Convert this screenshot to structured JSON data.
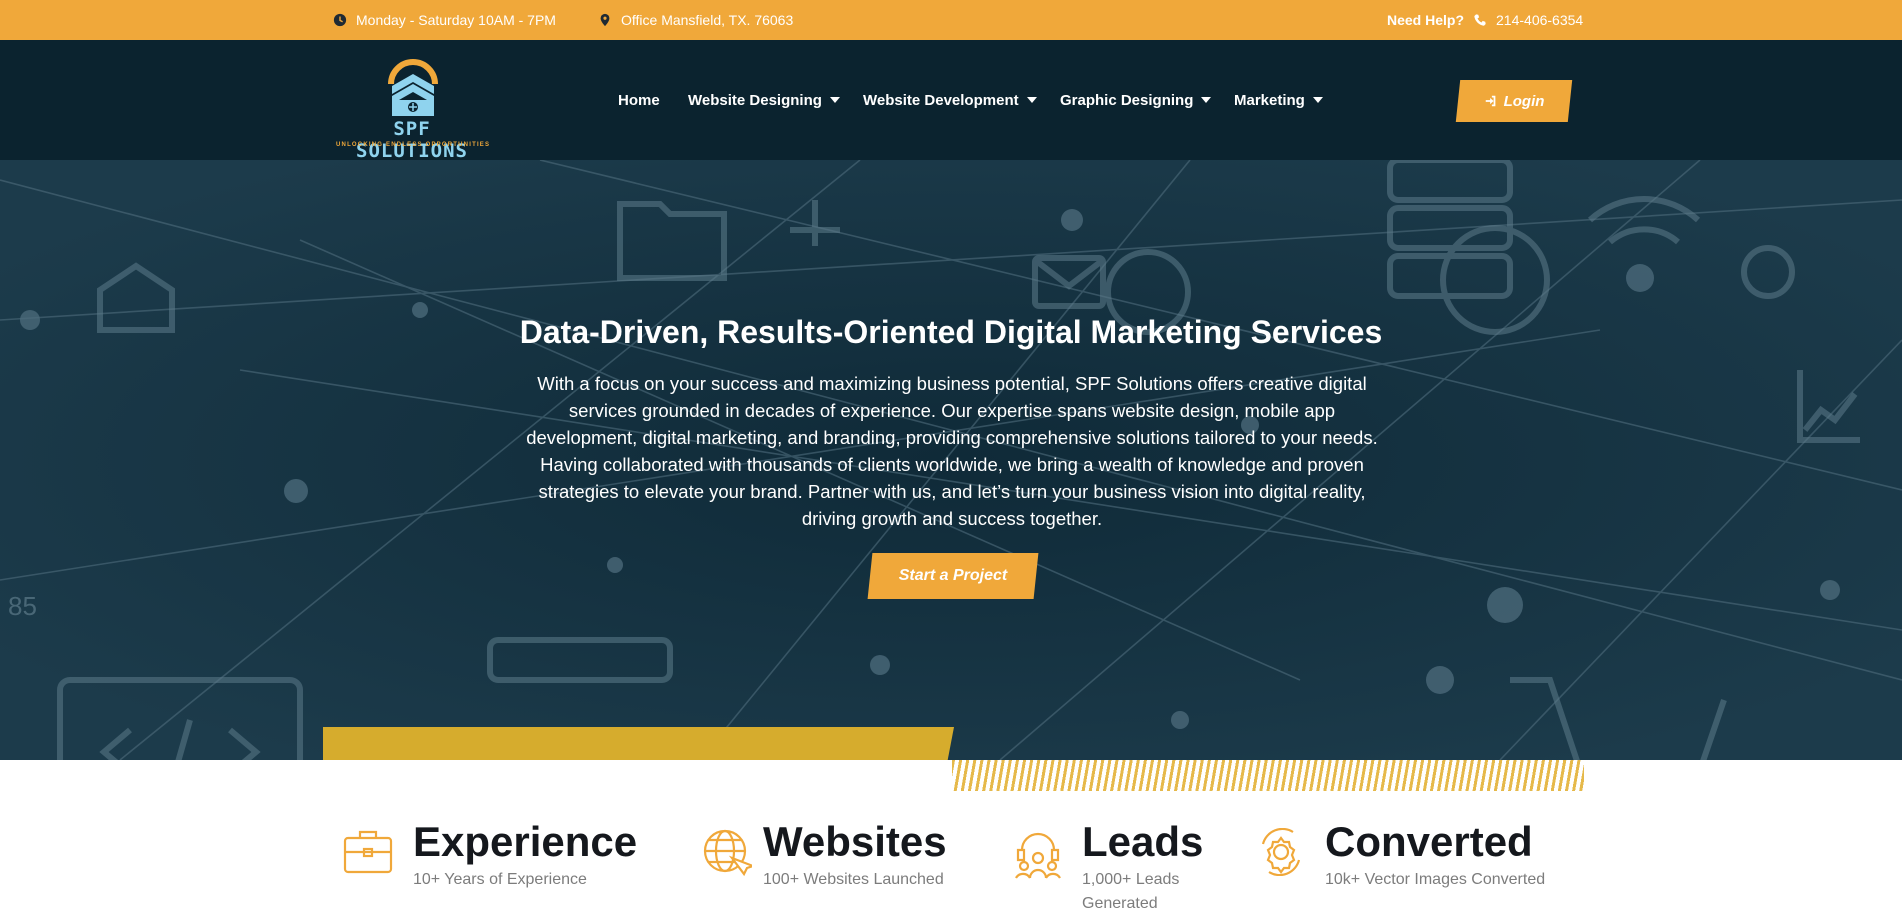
{
  "topbar": {
    "hours": "Monday - Saturday 10AM - 7PM",
    "office": "Office Mansfield, TX. 76063",
    "help_label": "Need Help?",
    "phone": "214-406-6354"
  },
  "brand": {
    "name": "SPF SOLUTIONS",
    "tagline": "UNLOCKING ENDLESS OPPORTUNITIES"
  },
  "nav": {
    "items": [
      {
        "label": "Home",
        "dropdown": false
      },
      {
        "label": "Website Designing",
        "dropdown": true
      },
      {
        "label": "Website Development",
        "dropdown": true
      },
      {
        "label": "Graphic Designing",
        "dropdown": true
      },
      {
        "label": "Marketing",
        "dropdown": true
      }
    ],
    "login_label": "Login"
  },
  "hero": {
    "title": "Data-Driven, Results-Oriented Digital Marketing Services",
    "body": "With a focus on your success and maximizing business potential, SPF Solutions offers creative digital services grounded in decades of experience. Our expertise spans website design, mobile app development, digital marketing, and branding, providing comprehensive solutions tailored to your needs. Having collaborated with thousands of clients worldwide, we bring a wealth of knowledge and proven strategies to elevate your brand. Partner with us, and let’s turn your business vision into digital reality, driving growth and success together.",
    "cta_label": "Start a Project"
  },
  "stats": [
    {
      "title": "Experience",
      "subtitle": "10+ Years of Experience",
      "icon": "briefcase-icon"
    },
    {
      "title": "Websites",
      "subtitle": "100+ Websites Launched",
      "icon": "globe-icon"
    },
    {
      "title": "Leads",
      "subtitle": "1,000+ Leads Generated",
      "icon": "users-icon"
    },
    {
      "title": "Converted",
      "subtitle": "10k+ Vector Images Converted",
      "icon": "gear-icon"
    }
  ],
  "colors": {
    "accent": "#f0a83a",
    "header_bg": "#0b232f",
    "hero_bg": "#102c3b",
    "gold": "#d6ac2d"
  }
}
